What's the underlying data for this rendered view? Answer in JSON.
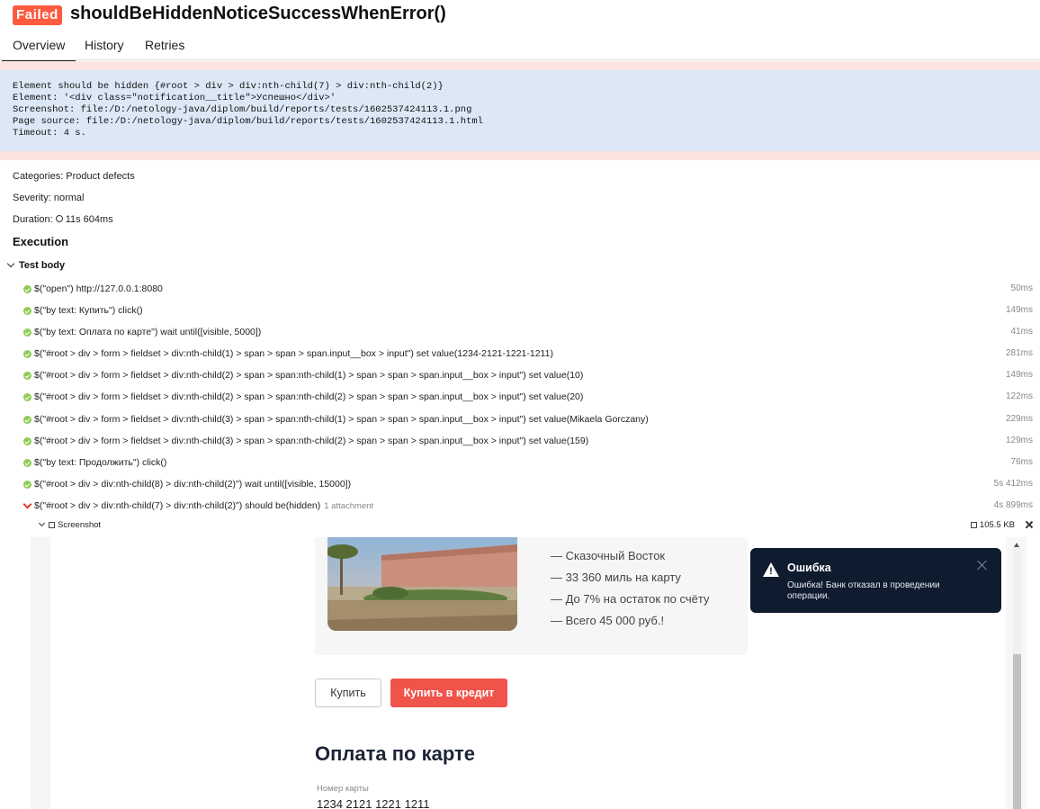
{
  "header": {
    "status": "Failed",
    "title": "shouldBeHiddenNoticeSuccessWhenError()"
  },
  "tabs": [
    {
      "label": "Overview",
      "active": true
    },
    {
      "label": "History",
      "active": false
    },
    {
      "label": "Retries",
      "active": false
    }
  ],
  "error": {
    "lines": [
      "Element should be hidden {#root > div > div:nth-child(7) > div:nth-child(2)}",
      "Element: '<div class=\"notification__title\">Успешно</div>'",
      "Screenshot: file:/D:/netology-java/diplom/build/reports/tests/1602537424113.1.png",
      "Page source: file:/D:/netology-java/diplom/build/reports/tests/1602537424113.1.html",
      "Timeout: 4 s."
    ]
  },
  "meta": {
    "categories": "Categories: Product defects",
    "severity": "Severity: normal",
    "duration_label": "Duration:",
    "duration_value": "11s 604ms"
  },
  "execution": {
    "title": "Execution",
    "test_body": "Test body",
    "steps": [
      {
        "status": "passed",
        "text": "$(\"open\") http://127.0.0.1:8080",
        "duration": "50ms"
      },
      {
        "status": "passed",
        "text": "$(\"by text: Купить\") click()",
        "duration": "149ms"
      },
      {
        "status": "passed",
        "text": "$(\"by text: Оплата по карте\") wait until([visible, 5000])",
        "duration": "41ms"
      },
      {
        "status": "passed",
        "text": "$(\"#root > div > form > fieldset > div:nth-child(1) > span > span > span.input__box > input\") set value(1234-2121-1221-1211)",
        "duration": "281ms"
      },
      {
        "status": "passed",
        "text": "$(\"#root > div > form > fieldset > div:nth-child(2) > span > span:nth-child(1) > span > span > span.input__box > input\") set value(10)",
        "duration": "149ms"
      },
      {
        "status": "passed",
        "text": "$(\"#root > div > form > fieldset > div:nth-child(2) > span > span:nth-child(2) > span > span > span.input__box > input\") set value(20)",
        "duration": "122ms"
      },
      {
        "status": "passed",
        "text": "$(\"#root > div > form > fieldset > div:nth-child(3) > span > span:nth-child(1) > span > span > span.input__box > input\") set value(Mikaela Gorczany)",
        "duration": "229ms"
      },
      {
        "status": "passed",
        "text": "$(\"#root > div > form > fieldset > div:nth-child(3) > span > span:nth-child(2) > span > span > span.input__box > input\") set value(159)",
        "duration": "129ms"
      },
      {
        "status": "passed",
        "text": "$(\"by text: Продолжить\") click()",
        "duration": "76ms"
      },
      {
        "status": "passed",
        "text": "$(\"#root > div > div:nth-child(8) > div:nth-child(2)\") wait until([visible, 15000])",
        "duration": "5s 412ms"
      },
      {
        "status": "failed",
        "text": "$(\"#root > div > div:nth-child(7) > div:nth-child(2)\") should be(hidden)",
        "note": "1 attachment",
        "duration": "4s 899ms"
      }
    ],
    "attachment": {
      "name": "Screenshot",
      "size": "105.5 KB"
    }
  },
  "screenshot": {
    "features": [
      "—  Сказочный Восток",
      "—  33 360 миль на карту",
      "—  До 7% на остаток по счёту",
      "—  Всего 45 000 руб.!"
    ],
    "buy_button": "Купить",
    "credit_button": "Купить в кредит",
    "pay_title": "Оплата по карте",
    "card_label": "Номер карты",
    "card_value": "1234 2121 1221 1211",
    "toast_title": "Ошибка",
    "toast_text": "Ошибка! Банк отказал в проведении операции."
  },
  "colors": {
    "failed": "#fd5a3e",
    "passed": "#8fcd55",
    "error_bg": "#fde4e1",
    "message_bg": "#dde8f7",
    "toast_bg": "#0f1b2e",
    "credit_btn": "#f0534a"
  }
}
